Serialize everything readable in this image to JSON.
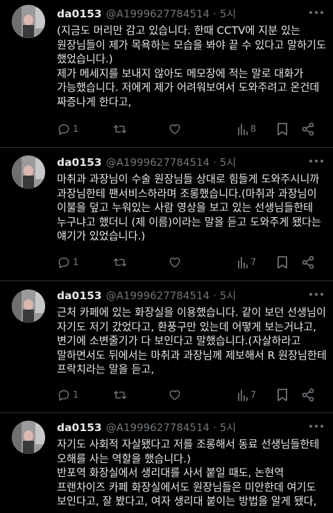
{
  "colors": {
    "background": "#000000",
    "text": "#e7e9ea",
    "muted": "#71767b",
    "divider": "#2f3336"
  },
  "tweets": [
    {
      "name": "da0153",
      "handle": "@A1999627784514",
      "dot": "·",
      "time": "5시",
      "lines": [
        "(지금도 머리만 감고 있습니다. 한때 CCTV에 지분 있는",
        "원장님들이 제가 목욕하는 모습을 봐야 끝 수 있다고 말하기도",
        "했었습니다.)",
        "제가 메세지를 보내지 않아도 메모장에 적는 말로 대화가",
        "가능했습니다. 저에게 제가 어려워보여서 도와주려고 온건데",
        "짜증나게 한다고,"
      ],
      "replies": "1",
      "retweets": "",
      "likes": "",
      "views": "8"
    },
    {
      "name": "da0153",
      "handle": "@A1999627784514",
      "dot": "·",
      "time": "5시",
      "lines": [
        "마취과 과장님이 수술 원장님들 상대로 힘들게 도와주시니까",
        "과장님한테 팬서비스하라며 조롱했습니다.(마취과 과장님이",
        "이불을 덮고 누워있는 사람 영상을 보고 있는 선생님들한테",
        "누구냐고 했더니 (제 이름)이라는 말을 듣고 도와주게 됐다는",
        "얘기가 있었습니다.)"
      ],
      "replies": "1",
      "retweets": "",
      "likes": "",
      "views": "7"
    },
    {
      "name": "da0153",
      "handle": "@A1999627784514",
      "dot": "·",
      "time": "5시",
      "lines": [
        "근처 카페에 있는 화장실을 이용했습니다. 같이 보던 선생님이",
        "자기도 저기 갔었다고, 환풍구만 있는데 어떻게 보는거냐고,",
        "변기에 소변줄기가 다 보인다고 말했습니다.(자살하라고",
        "말하면서도 뒤에서는 마취과 과장님께 제보해서 R 원장님한테",
        "프락치라는 말을 듣고,"
      ],
      "replies": "1",
      "retweets": "",
      "likes": "",
      "views": "7"
    },
    {
      "name": "da0153",
      "handle": "@A1999627784514",
      "dot": "·",
      "time": "5시",
      "lines": [
        "자기도 사회적 자살됐다고 저를 조롱해서 동료 선생님들한테",
        "오해를 사는 역할을 했습니다.)",
        "반포역 화장실에서 생리대를 사서 붙일 때도, 논현역",
        "프랜차이즈 카페 화장실에서도 원장님들은 미안한데 여기도",
        "보인다고, 잘 봤다고, 여자 생리대 붙이는 방법을 알게 됐다,"
      ]
    }
  ]
}
